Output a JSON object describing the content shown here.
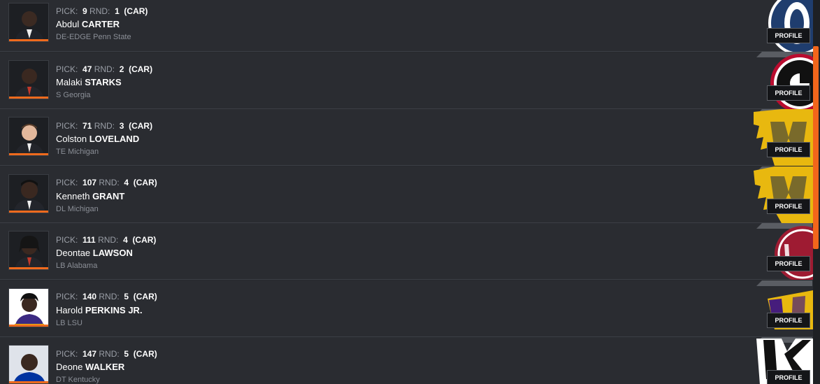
{
  "labels": {
    "pick": "PICK:",
    "round": "RND:",
    "profile": "PROFILE"
  },
  "accent_color": "#ef6a1d",
  "picks": [
    {
      "pick": "9",
      "round": "1",
      "team": "(CAR)",
      "first": "Abdul",
      "last": "CARTER",
      "position_school": "DE-EDGE Penn State",
      "logo": "penn-state-logo"
    },
    {
      "pick": "47",
      "round": "2",
      "team": "(CAR)",
      "first": "Malaki",
      "last": "STARKS",
      "position_school": "S Georgia",
      "logo": "georgia-logo"
    },
    {
      "pick": "71",
      "round": "3",
      "team": "(CAR)",
      "first": "Colston",
      "last": "LOVELAND",
      "position_school": "TE Michigan",
      "logo": "michigan-logo"
    },
    {
      "pick": "107",
      "round": "4",
      "team": "(CAR)",
      "first": "Kenneth",
      "last": "GRANT",
      "position_school": "DL Michigan",
      "logo": "michigan-logo"
    },
    {
      "pick": "111",
      "round": "4",
      "team": "(CAR)",
      "first": "Deontae",
      "last": "LAWSON",
      "position_school": "LB Alabama",
      "logo": "alabama-logo"
    },
    {
      "pick": "140",
      "round": "5",
      "team": "(CAR)",
      "first": "Harold",
      "last": "PERKINS JR.",
      "position_school": "LB LSU",
      "logo": "lsu-logo"
    },
    {
      "pick": "147",
      "round": "5",
      "team": "(CAR)",
      "first": "Deone",
      "last": "WALKER",
      "position_school": "DT Kentucky",
      "logo": "kentucky-logo"
    }
  ]
}
